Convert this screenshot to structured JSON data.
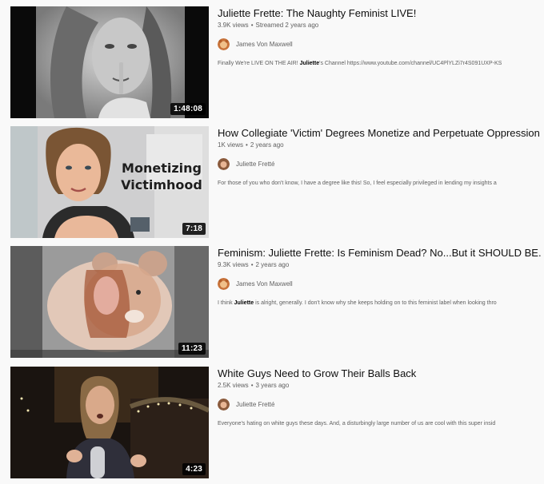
{
  "videos": [
    {
      "title": "Juliette Frette: The Naughty Feminist LIVE!",
      "views": "3.9K views",
      "age": "Streamed 2 years ago",
      "channel": "James Von Maxwell",
      "avatar_icon": "hamster-avatar-icon",
      "description_parts": [
        "Finally We're LIVE ON THE AIR! ",
        "Juliette",
        "'s Channel https://www.youtube.com/channel/UC4PlYLZi7r4S091UXP-KS"
      ],
      "duration": "1:48:08"
    },
    {
      "title": "How Collegiate 'Victim' Degrees Monetize and Perpetuate Oppression",
      "views": "1K views",
      "age": "2 years ago",
      "channel": "Juliette Fretté",
      "avatar_icon": "woman-avatar-icon",
      "description_parts": [
        "For those of you who don't know, I have a degree like this! So, I feel especially privileged in lending my insights a",
        "",
        ""
      ],
      "duration": "7:18",
      "thumb_text": [
        "Monetizing",
        "Victimhood"
      ]
    },
    {
      "title": "Feminism: Juliette Frette: Is Feminism Dead? No...But it SHOULD BE. You'v",
      "views": "9.3K views",
      "age": "2 years ago",
      "channel": "James Von Maxwell",
      "avatar_icon": "hamster-avatar-icon",
      "description_parts": [
        "I think ",
        "Juliette",
        " is alright, generally. I don't know why she keeps holding on to this feminist label when looking thro"
      ],
      "duration": "11:23"
    },
    {
      "title": "White Guys Need to Grow Their Balls Back",
      "views": "2.5K views",
      "age": "3 years ago",
      "channel": "Juliette Fretté",
      "avatar_icon": "woman-avatar-icon",
      "description_parts": [
        "Everyone's hating on white guys these days. And, a disturbingly large number of us are cool with this super insid",
        "",
        ""
      ],
      "duration": "4:23"
    }
  ],
  "colors": {
    "background": "#f9f9f9",
    "title": "#0f0f0f",
    "meta": "#606060"
  }
}
